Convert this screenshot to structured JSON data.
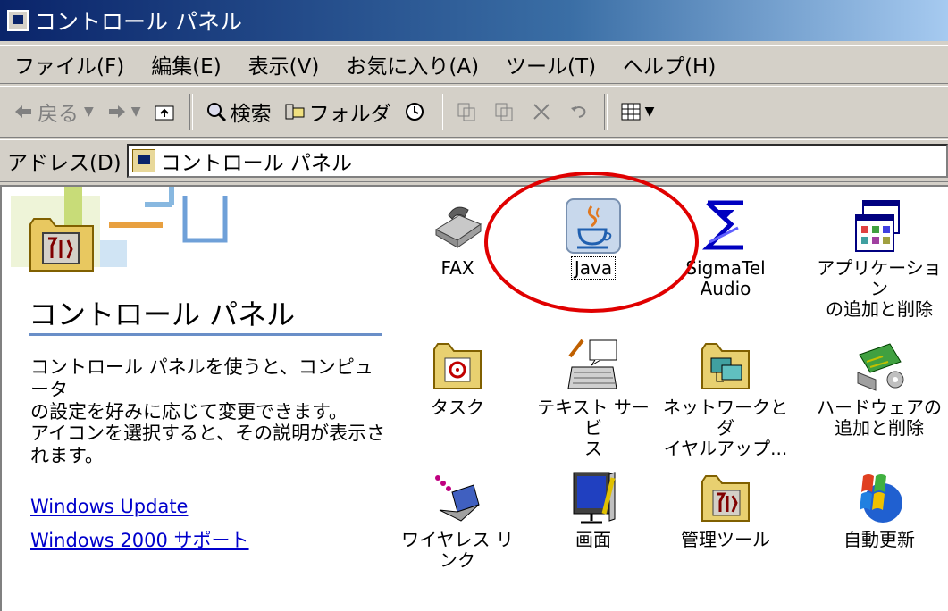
{
  "window": {
    "title": "コントロール パネル"
  },
  "menu": [
    "ファイル(F)",
    "編集(E)",
    "表示(V)",
    "お気に入り(A)",
    "ツール(T)",
    "ヘルプ(H)"
  ],
  "toolbar": {
    "back": "戻る",
    "search": "検索",
    "folders": "フォルダ"
  },
  "address": {
    "label": "アドレス(D)",
    "value": "コントロール パネル"
  },
  "left_panel": {
    "title": "コントロール パネル",
    "desc1_line1": "コントロール パネルを使うと、コンピュータ",
    "desc1_line2": "の設定を好みに応じて変更できます。",
    "desc2_line1": "アイコンを選択すると、その説明が表示さ",
    "desc2_line2": "れます。",
    "link1": "Windows Update",
    "link2": "Windows 2000 サポート"
  },
  "items": {
    "fax": {
      "line1": "FAX"
    },
    "java": {
      "line1": "Java"
    },
    "sigmatel": {
      "line1": "SigmaTel",
      "line2": "Audio"
    },
    "apps": {
      "line1": "アプリケーション",
      "line2": "の追加と削除"
    },
    "task": {
      "line1": "タスク"
    },
    "text": {
      "line1": "テキスト サービ",
      "line2": "ス"
    },
    "network": {
      "line1": "ネットワークとダ",
      "line2": "イヤルアップ..."
    },
    "hardware": {
      "line1": "ハードウェアの",
      "line2": "追加と削除"
    },
    "wireless": {
      "line1": "ワイヤレス リンク"
    },
    "display": {
      "line1": "画面"
    },
    "admin": {
      "line1": "管理ツール"
    },
    "update": {
      "line1": "自動更新"
    }
  },
  "colors": {
    "titlebar": "#0a246a",
    "annotation_circle": "#e00000",
    "link": "#0000cc"
  }
}
